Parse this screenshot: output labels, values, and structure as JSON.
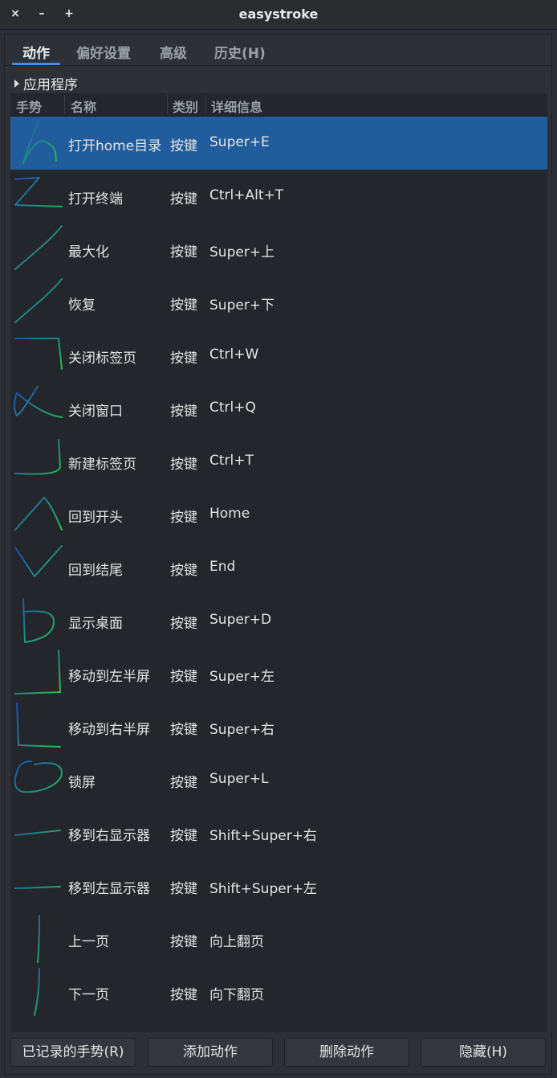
{
  "window": {
    "title": "easystroke",
    "close": "×",
    "minimize": "–",
    "maximize": "+"
  },
  "tabs": [
    "动作",
    "偏好设置",
    "高级",
    "历史(H)"
  ],
  "apps_label": "应用程序",
  "columns": {
    "gesture": "手势",
    "name": "名称",
    "type": "类别",
    "detail": "详细信息"
  },
  "rows": [
    {
      "name": "打开home目录",
      "type": "按键",
      "detail": "Super+E",
      "gesture": "home-stroke-icon"
    },
    {
      "name": "打开终端",
      "type": "按键",
      "detail": "Ctrl+Alt+T",
      "gesture": "z-stroke-icon"
    },
    {
      "name": "最大化",
      "type": "按键",
      "detail": "Super+上",
      "gesture": "diagonal-up-stroke-icon"
    },
    {
      "name": "恢复",
      "type": "按键",
      "detail": "Super+下",
      "gesture": "diagonal-up-stroke-icon"
    },
    {
      "name": "关闭标签页",
      "type": "按键",
      "detail": "Ctrl+W",
      "gesture": "right-down-stroke-icon"
    },
    {
      "name": "关闭窗口",
      "type": "按键",
      "detail": "Ctrl+Q",
      "gesture": "alpha-stroke-icon"
    },
    {
      "name": "新建标签页",
      "type": "按键",
      "detail": "Ctrl+T",
      "gesture": "j-stroke-icon"
    },
    {
      "name": "回到开头",
      "type": "按键",
      "detail": "Home",
      "gesture": "caret-up-stroke-icon"
    },
    {
      "name": "回到结尾",
      "type": "按键",
      "detail": "End",
      "gesture": "v-stroke-icon"
    },
    {
      "name": "显示桌面",
      "type": "按键",
      "detail": "Super+D",
      "gesture": "d-stroke-icon"
    },
    {
      "name": "移动到左半屏",
      "type": "按键",
      "detail": "Super+左",
      "gesture": "down-left-stroke-icon"
    },
    {
      "name": "移动到右半屏",
      "type": "按键",
      "detail": "Super+右",
      "gesture": "l-stroke-icon"
    },
    {
      "name": "锁屏",
      "type": "按键",
      "detail": "Super+L",
      "gesture": "circle-stroke-icon"
    },
    {
      "name": "移到右显示器",
      "type": "按键",
      "detail": "Shift+Super+右",
      "gesture": "right-stroke-icon"
    },
    {
      "name": "移到左显示器",
      "type": "按键",
      "detail": "Shift+Super+左",
      "gesture": "left-stroke-icon"
    },
    {
      "name": "上一页",
      "type": "按键",
      "detail": "向上翻页",
      "gesture": "up-stroke-icon"
    },
    {
      "name": "下一页",
      "type": "按键",
      "detail": "向下翻页",
      "gesture": "down-stroke-icon"
    }
  ],
  "buttons": {
    "recorded": "已记录的手势(R)",
    "add": "添加动作",
    "delete": "删除动作",
    "hide": "隐藏(H)"
  },
  "colors": {
    "selection": "#215d9c",
    "stroke_start": "#1b3bd0",
    "stroke_end": "#25d43a"
  }
}
